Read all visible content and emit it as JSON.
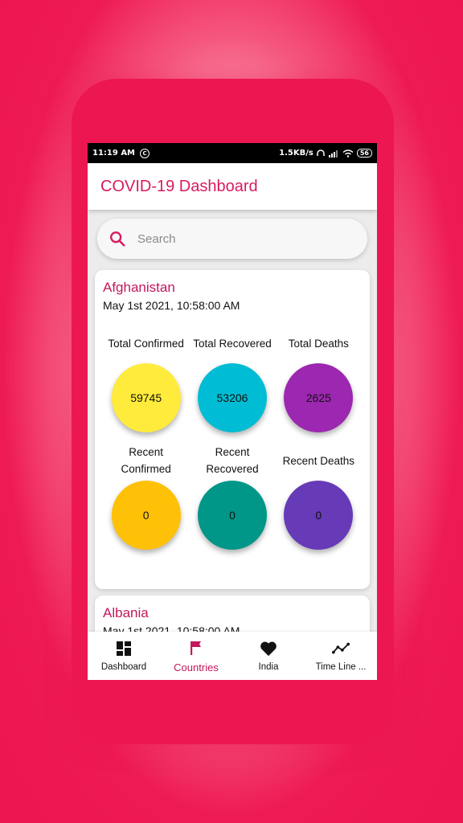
{
  "status_bar": {
    "time": "11:19 AM",
    "c_icon_text": "C",
    "network_speed": "1.5KB/s",
    "battery": "56"
  },
  "app_bar": {
    "title": "COVID-19 Dashboard"
  },
  "search": {
    "placeholder": "Search"
  },
  "countries": [
    {
      "name": "Afghanistan",
      "date": "May 1st 2021, 10:58:00 AM",
      "stats": [
        {
          "label": "Total Confirmed",
          "value": "59745",
          "color": "#ffeb3b"
        },
        {
          "label": "Total Recovered",
          "value": "53206",
          "color": "#00bcd4"
        },
        {
          "label": "Total Deaths",
          "value": "2625",
          "color": "#9c27b0"
        },
        {
          "label": "Recent Confirmed",
          "value": "0",
          "color": "#ffc107"
        },
        {
          "label": "Recent Recovered",
          "value": "0",
          "color": "#009688"
        },
        {
          "label": "Recent Deaths",
          "value": "0",
          "color": "#673ab7"
        }
      ]
    },
    {
      "name": "Albania",
      "date": "May 1st 2021, 10:58:00 AM"
    }
  ],
  "bottom_nav": [
    {
      "label": "Dashboard",
      "icon": "dashboard-icon",
      "active": false
    },
    {
      "label": "Countries",
      "icon": "flag-icon",
      "active": true
    },
    {
      "label": "India",
      "icon": "heart-icon",
      "active": false
    },
    {
      "label": "Time Line ...",
      "icon": "timeline-icon",
      "active": false
    }
  ],
  "colors": {
    "accent": "#d81b60",
    "phone": "#ec1650"
  }
}
